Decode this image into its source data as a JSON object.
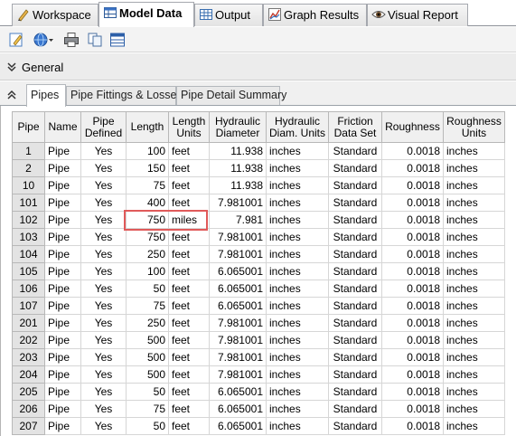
{
  "top_tabs": [
    {
      "label": "Workspace",
      "icon": "pencil-ruler-icon"
    },
    {
      "label": "Model Data",
      "icon": "model-data-icon"
    },
    {
      "label": "Output",
      "icon": "table-icon"
    },
    {
      "label": "Graph Results",
      "icon": "graph-icon"
    },
    {
      "label": "Visual Report",
      "icon": "eye-icon"
    }
  ],
  "general_label": "General",
  "sub_tabs": [
    "Pipes",
    "Pipe Fittings & Losses",
    "Pipe Detail Summary"
  ],
  "columns": [
    "Pipe",
    "Name",
    "Pipe Defined",
    "Length",
    "Length Units",
    "Hydraulic Diameter",
    "Hydraulic Diam. Units",
    "Friction Data Set",
    "Roughness",
    "Roughness Units"
  ],
  "rows": [
    [
      "1",
      "Pipe",
      "Yes",
      "100",
      "feet",
      "11.938",
      "inches",
      "Standard",
      "0.0018",
      "inches"
    ],
    [
      "2",
      "Pipe",
      "Yes",
      "150",
      "feet",
      "11.938",
      "inches",
      "Standard",
      "0.0018",
      "inches"
    ],
    [
      "10",
      "Pipe",
      "Yes",
      "75",
      "feet",
      "11.938",
      "inches",
      "Standard",
      "0.0018",
      "inches"
    ],
    [
      "101",
      "Pipe",
      "Yes",
      "400",
      "feet",
      "7.981001",
      "inches",
      "Standard",
      "0.0018",
      "inches"
    ],
    [
      "102",
      "Pipe",
      "Yes",
      "750",
      "miles",
      "7.981",
      "inches",
      "Standard",
      "0.0018",
      "inches"
    ],
    [
      "103",
      "Pipe",
      "Yes",
      "750",
      "feet",
      "7.981001",
      "inches",
      "Standard",
      "0.0018",
      "inches"
    ],
    [
      "104",
      "Pipe",
      "Yes",
      "250",
      "feet",
      "7.981001",
      "inches",
      "Standard",
      "0.0018",
      "inches"
    ],
    [
      "105",
      "Pipe",
      "Yes",
      "100",
      "feet",
      "6.065001",
      "inches",
      "Standard",
      "0.0018",
      "inches"
    ],
    [
      "106",
      "Pipe",
      "Yes",
      "50",
      "feet",
      "6.065001",
      "inches",
      "Standard",
      "0.0018",
      "inches"
    ],
    [
      "107",
      "Pipe",
      "Yes",
      "75",
      "feet",
      "6.065001",
      "inches",
      "Standard",
      "0.0018",
      "inches"
    ],
    [
      "201",
      "Pipe",
      "Yes",
      "250",
      "feet",
      "7.981001",
      "inches",
      "Standard",
      "0.0018",
      "inches"
    ],
    [
      "202",
      "Pipe",
      "Yes",
      "500",
      "feet",
      "7.981001",
      "inches",
      "Standard",
      "0.0018",
      "inches"
    ],
    [
      "203",
      "Pipe",
      "Yes",
      "500",
      "feet",
      "7.981001",
      "inches",
      "Standard",
      "0.0018",
      "inches"
    ],
    [
      "204",
      "Pipe",
      "Yes",
      "500",
      "feet",
      "7.981001",
      "inches",
      "Standard",
      "0.0018",
      "inches"
    ],
    [
      "205",
      "Pipe",
      "Yes",
      "50",
      "feet",
      "6.065001",
      "inches",
      "Standard",
      "0.0018",
      "inches"
    ],
    [
      "206",
      "Pipe",
      "Yes",
      "75",
      "feet",
      "6.065001",
      "inches",
      "Standard",
      "0.0018",
      "inches"
    ],
    [
      "207",
      "Pipe",
      "Yes",
      "50",
      "feet",
      "6.065001",
      "inches",
      "Standard",
      "0.0018",
      "inches"
    ]
  ],
  "highlighted_row": "102",
  "highlight_color": "#e05a5a"
}
